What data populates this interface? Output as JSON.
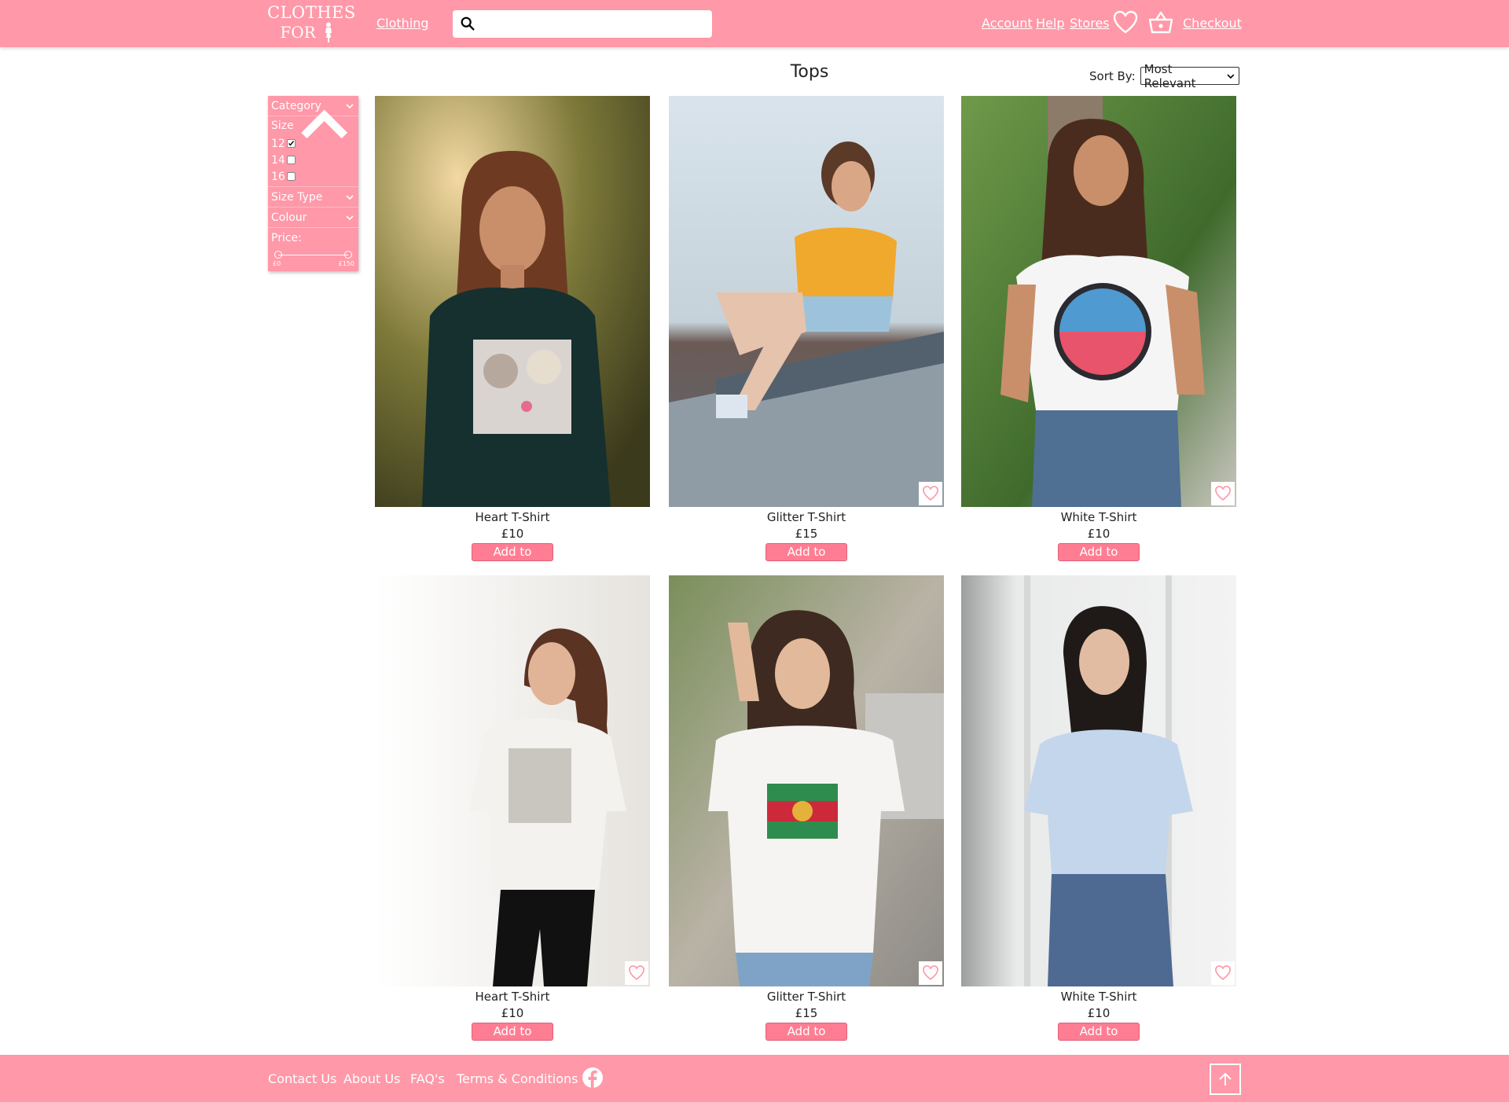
{
  "header": {
    "logo_line1": "CLOTHES",
    "logo_line2": "FOR",
    "nav_clothing": "Clothing",
    "search_placeholder": "",
    "account": "Account",
    "help": "Help",
    "stores": "Stores",
    "checkout": "Checkout",
    "icons": [
      "search-icon",
      "heart-icon",
      "basket-icon"
    ]
  },
  "page": {
    "title": "Tops",
    "sort_label": "Sort By:",
    "sort_value": "Most Relevant"
  },
  "filters": {
    "category": "Category",
    "size": "Size",
    "size_options": [
      {
        "label": "12",
        "checked": true
      },
      {
        "label": "14",
        "checked": false
      },
      {
        "label": "16",
        "checked": false
      }
    ],
    "size_type": "Size Type",
    "colour": "Colour",
    "price_label": "Price:",
    "price_min": "£0",
    "price_max": "£150"
  },
  "products": [
    {
      "name": "Heart T-Shirt",
      "price": "£10",
      "button": "Add to Basket"
    },
    {
      "name": "Glitter T-Shirt",
      "price": "£15",
      "button": "Add to Basket"
    },
    {
      "name": "White T-Shirt",
      "price": "£10",
      "button": "Add to Basket"
    },
    {
      "name": "Heart T-Shirt",
      "price": "£10",
      "button": "Add to Basket"
    },
    {
      "name": "Glitter T-Shirt",
      "price": "£15",
      "button": "Add to Basket"
    },
    {
      "name": "White T-Shirt",
      "price": "£10",
      "button": "Add to Basket"
    }
  ],
  "footer": {
    "contact": "Contact Us",
    "about": "About Us",
    "faqs": "FAQ's",
    "terms": "Terms & Conditions",
    "icons": [
      "facebook-icon",
      "arrow-up-icon"
    ]
  },
  "colors": {
    "brand_pink": "#ff98a8",
    "button_pink": "#ff7d92"
  }
}
